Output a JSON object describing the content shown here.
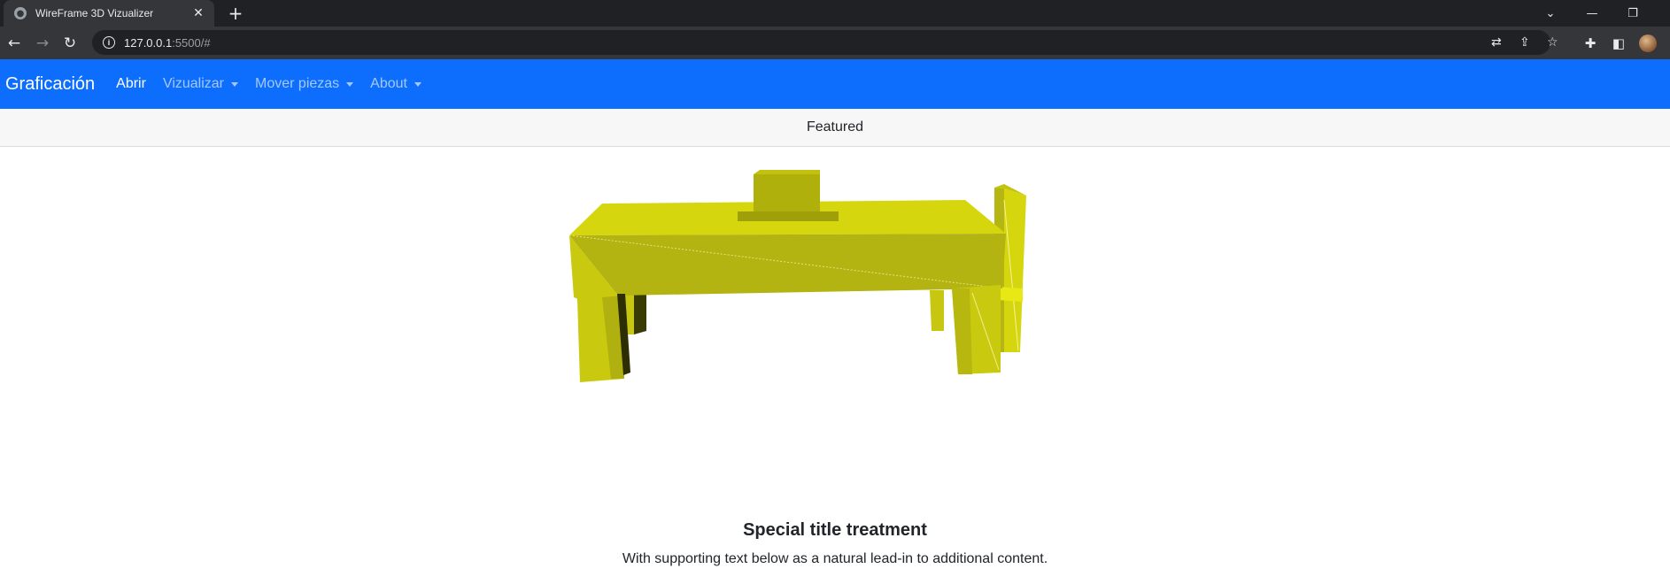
{
  "browser": {
    "tab_title": "WireFrame 3D Vizualizer",
    "url_host": "127.0.0.1",
    "url_path": ":5500/#"
  },
  "navbar": {
    "brand": "Graficación",
    "items": [
      {
        "label": "Abrir",
        "active": true,
        "dropdown": false
      },
      {
        "label": "Vizualizar",
        "active": false,
        "dropdown": true
      },
      {
        "label": "Mover piezas",
        "active": false,
        "dropdown": true
      },
      {
        "label": "About",
        "active": false,
        "dropdown": true
      }
    ]
  },
  "card": {
    "header": "Featured",
    "title": "Special title treatment",
    "text": "With supporting text below as a natural lead-in to additional content."
  },
  "colors": {
    "navbar_bg": "#0d6efd",
    "model_light": "#d6d60e",
    "model_mid": "#b5b514",
    "model_dark": "#8f8f08"
  },
  "icons": [
    "globe-icon",
    "close-icon",
    "plus-icon",
    "back-icon",
    "forward-icon",
    "reload-icon",
    "info-icon",
    "translate-icon",
    "share-icon",
    "star-icon",
    "extensions-icon",
    "sidepanel-icon",
    "profile-avatar",
    "minimize-icon",
    "restore-icon",
    "tab-search-icon"
  ]
}
